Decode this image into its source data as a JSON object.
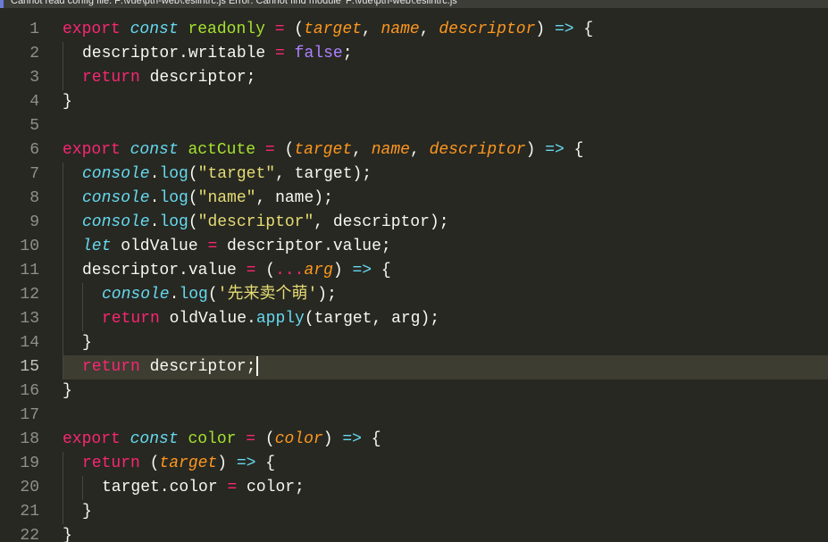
{
  "error_bar": {
    "message": "Cannot read config file: F:\\vue\\ptn-web\\.eslintrc.js Error: Cannot find module 'F:\\vue\\ptn-web\\.eslintrc.js'"
  },
  "editor": {
    "current_line": 15,
    "colors": {
      "background": "#272822",
      "keyword": "#f92672",
      "storage": "#66d9ef",
      "function": "#a6e22e",
      "parameter": "#fd971f",
      "string": "#e6db74",
      "boolean": "#ae81ff",
      "text": "#f8f8f2"
    },
    "lines": [
      {
        "num": "1",
        "indent": 0,
        "tokens": [
          [
            "kw",
            "export"
          ],
          [
            "pl",
            " "
          ],
          [
            "st",
            "const"
          ],
          [
            "pl",
            " "
          ],
          [
            "fn",
            "readonly"
          ],
          [
            "pl",
            " "
          ],
          [
            "op",
            "="
          ],
          [
            "pl",
            " ("
          ],
          [
            "pa",
            "target"
          ],
          [
            "pl",
            ", "
          ],
          [
            "pa",
            "name"
          ],
          [
            "pl",
            ", "
          ],
          [
            "pa",
            "descriptor"
          ],
          [
            "pl",
            ") "
          ],
          [
            "ar",
            "=>"
          ],
          [
            "pl",
            " {"
          ]
        ]
      },
      {
        "num": "2",
        "indent": 1,
        "tokens": [
          [
            "pl",
            "descriptor.writable "
          ],
          [
            "op",
            "="
          ],
          [
            "pl",
            " "
          ],
          [
            "bo",
            "false"
          ],
          [
            "pl",
            ";"
          ]
        ]
      },
      {
        "num": "3",
        "indent": 1,
        "tokens": [
          [
            "kw",
            "return"
          ],
          [
            "pl",
            " descriptor;"
          ]
        ]
      },
      {
        "num": "4",
        "indent": 0,
        "tokens": [
          [
            "pl",
            "}"
          ]
        ]
      },
      {
        "num": "5",
        "indent": 0,
        "tokens": []
      },
      {
        "num": "6",
        "indent": 0,
        "tokens": [
          [
            "kw",
            "export"
          ],
          [
            "pl",
            " "
          ],
          [
            "st",
            "const"
          ],
          [
            "pl",
            " "
          ],
          [
            "fn",
            "actCute"
          ],
          [
            "pl",
            " "
          ],
          [
            "op",
            "="
          ],
          [
            "pl",
            " ("
          ],
          [
            "pa",
            "target"
          ],
          [
            "pl",
            ", "
          ],
          [
            "pa",
            "name"
          ],
          [
            "pl",
            ", "
          ],
          [
            "pa",
            "descriptor"
          ],
          [
            "pl",
            ") "
          ],
          [
            "ar",
            "=>"
          ],
          [
            "pl",
            " {"
          ]
        ]
      },
      {
        "num": "7",
        "indent": 1,
        "tokens": [
          [
            "bi",
            "console"
          ],
          [
            "pl",
            "."
          ],
          [
            "mt",
            "log"
          ],
          [
            "pl",
            "("
          ],
          [
            "sg",
            "\"target\""
          ],
          [
            "pl",
            ", target);"
          ]
        ]
      },
      {
        "num": "8",
        "indent": 1,
        "tokens": [
          [
            "bi",
            "console"
          ],
          [
            "pl",
            "."
          ],
          [
            "mt",
            "log"
          ],
          [
            "pl",
            "("
          ],
          [
            "sg",
            "\"name\""
          ],
          [
            "pl",
            ", name);"
          ]
        ]
      },
      {
        "num": "9",
        "indent": 1,
        "tokens": [
          [
            "bi",
            "console"
          ],
          [
            "pl",
            "."
          ],
          [
            "mt",
            "log"
          ],
          [
            "pl",
            "("
          ],
          [
            "sg",
            "\"descriptor\""
          ],
          [
            "pl",
            ", descriptor);"
          ]
        ]
      },
      {
        "num": "10",
        "indent": 1,
        "tokens": [
          [
            "st",
            "let"
          ],
          [
            "pl",
            " oldValue "
          ],
          [
            "op",
            "="
          ],
          [
            "pl",
            " descriptor.value;"
          ]
        ]
      },
      {
        "num": "11",
        "indent": 1,
        "tokens": [
          [
            "pl",
            "descriptor.value "
          ],
          [
            "op",
            "="
          ],
          [
            "pl",
            " ("
          ],
          [
            "op",
            "..."
          ],
          [
            "pa",
            "arg"
          ],
          [
            "pl",
            ") "
          ],
          [
            "ar",
            "=>"
          ],
          [
            "pl",
            " {"
          ]
        ]
      },
      {
        "num": "12",
        "indent": 2,
        "tokens": [
          [
            "bi",
            "console"
          ],
          [
            "pl",
            "."
          ],
          [
            "mt",
            "log"
          ],
          [
            "pl",
            "("
          ],
          [
            "sg",
            "'先来卖个萌'"
          ],
          [
            "pl",
            ");"
          ]
        ]
      },
      {
        "num": "13",
        "indent": 2,
        "tokens": [
          [
            "kw",
            "return"
          ],
          [
            "pl",
            " oldValue."
          ],
          [
            "mt",
            "apply"
          ],
          [
            "pl",
            "(target, arg);"
          ]
        ]
      },
      {
        "num": "14",
        "indent": 1,
        "tokens": [
          [
            "pl",
            "}"
          ]
        ]
      },
      {
        "num": "15",
        "indent": 1,
        "tokens": [
          [
            "kw",
            "return"
          ],
          [
            "pl",
            " descriptor;"
          ]
        ]
      },
      {
        "num": "16",
        "indent": 0,
        "tokens": [
          [
            "pl",
            "}"
          ]
        ]
      },
      {
        "num": "17",
        "indent": 0,
        "tokens": []
      },
      {
        "num": "18",
        "indent": 0,
        "tokens": [
          [
            "kw",
            "export"
          ],
          [
            "pl",
            " "
          ],
          [
            "st",
            "const"
          ],
          [
            "pl",
            " "
          ],
          [
            "fn",
            "color"
          ],
          [
            "pl",
            " "
          ],
          [
            "op",
            "="
          ],
          [
            "pl",
            " ("
          ],
          [
            "pa",
            "color"
          ],
          [
            "pl",
            ") "
          ],
          [
            "ar",
            "=>"
          ],
          [
            "pl",
            " {"
          ]
        ]
      },
      {
        "num": "19",
        "indent": 1,
        "tokens": [
          [
            "kw",
            "return"
          ],
          [
            "pl",
            " ("
          ],
          [
            "pa",
            "target"
          ],
          [
            "pl",
            ") "
          ],
          [
            "ar",
            "=>"
          ],
          [
            "pl",
            " {"
          ]
        ]
      },
      {
        "num": "20",
        "indent": 2,
        "tokens": [
          [
            "pl",
            "target.color "
          ],
          [
            "op",
            "="
          ],
          [
            "pl",
            " color;"
          ]
        ]
      },
      {
        "num": "21",
        "indent": 1,
        "tokens": [
          [
            "pl",
            "}"
          ]
        ]
      },
      {
        "num": "22",
        "indent": 0,
        "tokens": [
          [
            "pl",
            "}"
          ]
        ]
      }
    ]
  }
}
